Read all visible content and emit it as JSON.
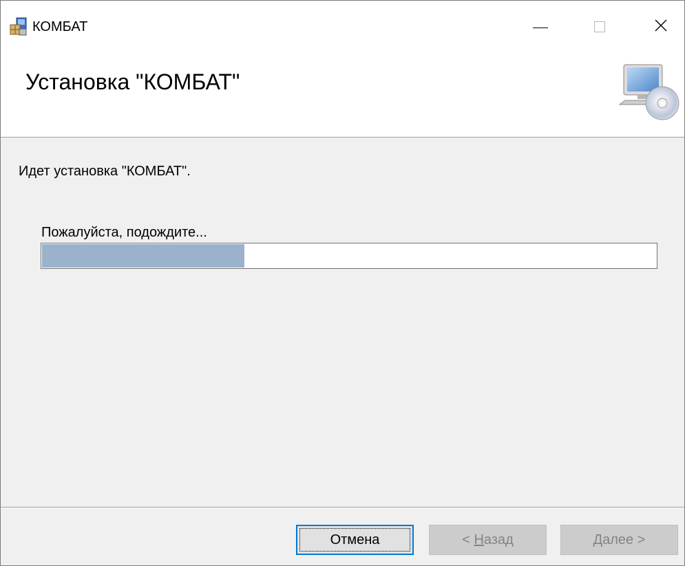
{
  "window": {
    "title": "КОМБАТ",
    "controls": {
      "minimize": "minimize",
      "maximize": "maximize",
      "close": "close"
    }
  },
  "banner": {
    "title": "Установка \"КОМБАТ\""
  },
  "content": {
    "status": "Идет установка \"КОМБАТ\".",
    "wait_label": "Пожалуйста, подождите...",
    "progress_percent": 33
  },
  "buttons": {
    "cancel": "Отмена",
    "back_prefix": "< ",
    "back_hotkey": "Н",
    "back_rest": "азад",
    "next_hotkey": "Д",
    "next_rest": "алее >"
  },
  "colors": {
    "progress_fill": "#9bb2cd",
    "focus_border": "#0078d7",
    "disabled_text": "#838383"
  },
  "icons": {
    "app": "installer-package-icon",
    "banner": "computer-cd-setup-icon"
  }
}
